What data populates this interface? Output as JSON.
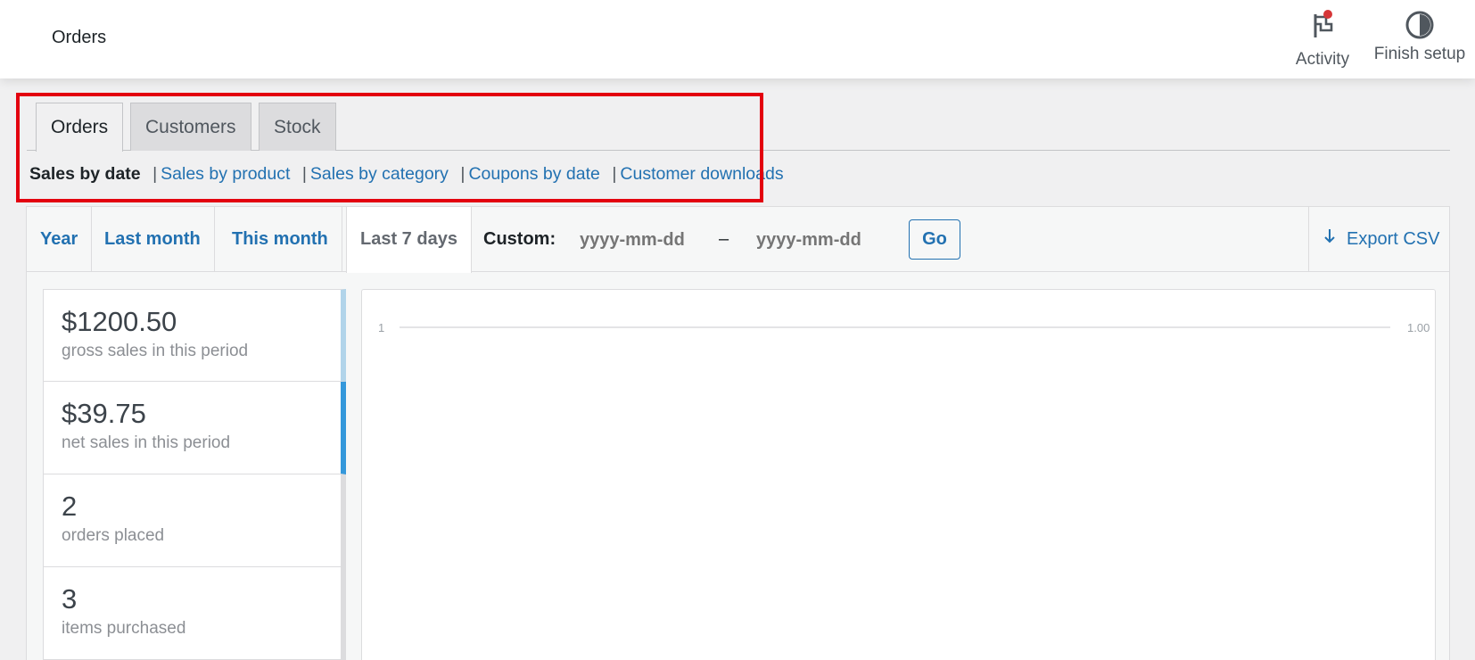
{
  "header": {
    "title": "Orders",
    "actions": [
      {
        "label": "Activity",
        "icon": "flag-icon"
      },
      {
        "label": "Finish setup",
        "icon": "half-circle-icon"
      }
    ]
  },
  "report_tabs": [
    {
      "label": "Orders",
      "active": true
    },
    {
      "label": "Customers",
      "active": false
    },
    {
      "label": "Stock",
      "active": false
    }
  ],
  "subsub": {
    "current": "Sales by date",
    "links": [
      "Sales by product",
      "Sales by category",
      "Coupons by date",
      "Customer downloads"
    ],
    "separator": "|"
  },
  "ranges": {
    "items": [
      "Year",
      "Last month",
      "This month",
      "Last 7 days"
    ],
    "active": "Last 7 days",
    "custom_label": "Custom:",
    "date_placeholder": "yyyy-mm-dd",
    "dash": "–",
    "go_label": "Go",
    "export_label": "Export CSV"
  },
  "legend": [
    {
      "amount": "$1200.50",
      "desc": "gross sales in this period",
      "color": "#b1d4ea"
    },
    {
      "amount": "$39.75",
      "desc": "net sales in this period",
      "color": "#3498db"
    },
    {
      "amount": "2",
      "desc": "orders placed",
      "color": "#dcdcde"
    },
    {
      "amount": "3",
      "desc": "items purchased",
      "color": "#dcdcde"
    }
  ],
  "chart": {
    "left_tick": "1",
    "right_tick": "1.00"
  },
  "colors": {
    "link": "#2271b1",
    "highlight": "#e3000f",
    "notification_dot": "#d63638"
  }
}
